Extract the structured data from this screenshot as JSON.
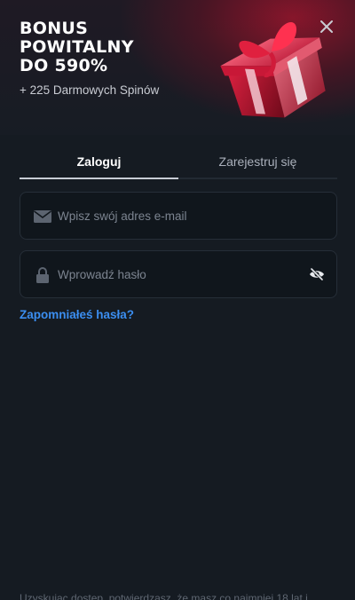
{
  "hero": {
    "title_lines": [
      "BONUS",
      "POWITALNY",
      "DO 590%"
    ],
    "subtitle": "+ 225 Darmowych Spinów",
    "close_icon": "close-icon",
    "gift_icon": "gift-box-icon",
    "accent": "#b3102f"
  },
  "tabs": [
    {
      "label": "Zaloguj",
      "active": true
    },
    {
      "label": "Zarejestruj się",
      "active": false
    }
  ],
  "email": {
    "placeholder": "Wpisz swój adres e-mail",
    "value": "",
    "icon": "envelope-icon"
  },
  "password": {
    "placeholder": "Wprowadź hasło",
    "value": "",
    "icon": "lock-icon",
    "toggle_icon": "eye-slash-icon"
  },
  "forgot_link": "Zapomniałeś hasła?",
  "legal_text": "Uzyskując dostęp, potwierdzasz, że masz co najmniej 18 lat i",
  "colors": {
    "background": "#151b22",
    "field_bg": "#10161c",
    "link": "#3b8ef0"
  }
}
